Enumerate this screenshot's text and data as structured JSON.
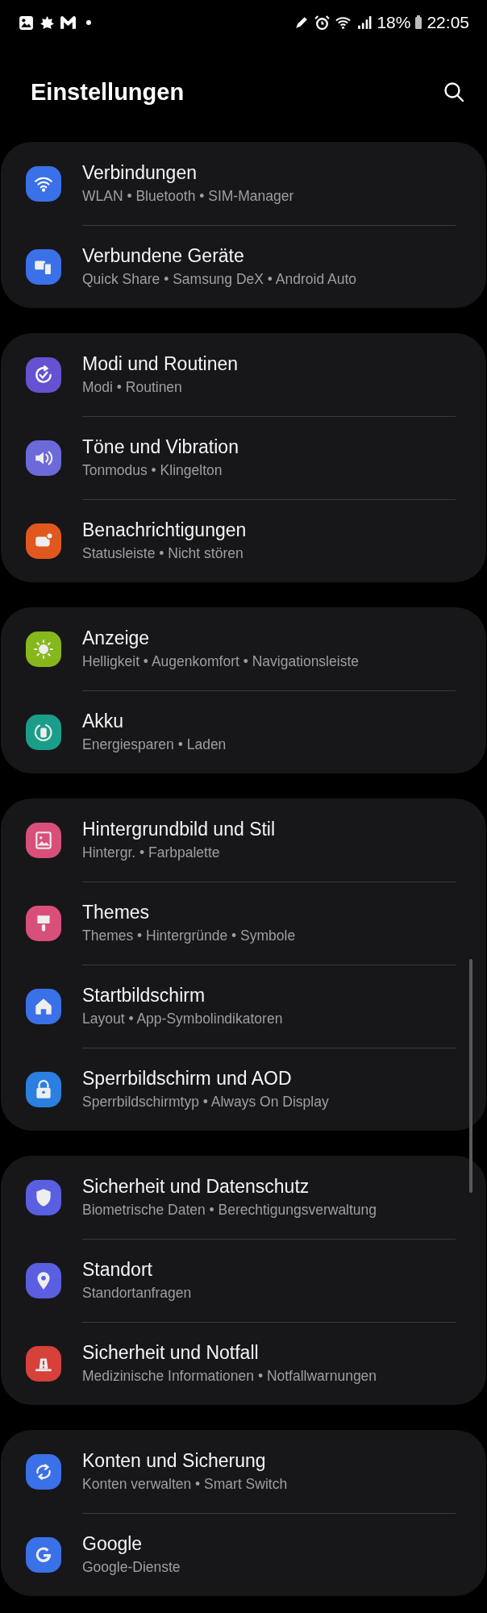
{
  "status_bar": {
    "battery": "18%",
    "time": "22:05"
  },
  "header": {
    "title": "Einstellungen"
  },
  "groups": [
    {
      "items": [
        {
          "kind": "wifi",
          "color": "#3a70e8",
          "title": "Verbindungen",
          "subtitle": "WLAN • Bluetooth • SIM-Manager"
        },
        {
          "kind": "devices",
          "color": "#3a70e8",
          "title": "Verbundene Geräte",
          "subtitle": "Quick Share • Samsung DeX • Android Auto"
        }
      ]
    },
    {
      "items": [
        {
          "kind": "modes",
          "color": "#6452d0",
          "title": "Modi und Routinen",
          "subtitle": "Modi • Routinen"
        },
        {
          "kind": "sound",
          "color": "#6c6ad8",
          "title": "Töne und Vibration",
          "subtitle": "Tonmodus • Klingelton"
        },
        {
          "kind": "notification",
          "color": "#e0581e",
          "title": "Benachrichtigungen",
          "subtitle": "Statusleiste • Nicht stören"
        }
      ]
    },
    {
      "items": [
        {
          "kind": "display",
          "color": "#86b81c",
          "title": "Anzeige",
          "subtitle": "Helligkeit • Augenkomfort • Navigationsleiste"
        },
        {
          "kind": "battery",
          "color": "#1a9e8a",
          "title": "Akku",
          "subtitle": "Energiesparen • Laden"
        }
      ]
    },
    {
      "items": [
        {
          "kind": "wallpaper",
          "color": "#d8507a",
          "title": "Hintergrundbild und Stil",
          "subtitle": "Hintergr. • Farbpalette"
        },
        {
          "kind": "themes",
          "color": "#d8507a",
          "title": "Themes",
          "subtitle": "Themes • Hintergründe • Symbole"
        },
        {
          "kind": "home",
          "color": "#3a70e8",
          "title": "Startbildschirm",
          "subtitle": "Layout • App-Symbolindikatoren"
        },
        {
          "kind": "lock",
          "color": "#2a7fe0",
          "title": "Sperrbildschirm und AOD",
          "subtitle": "Sperrbildschirmtyp • Always On Display"
        }
      ]
    },
    {
      "items": [
        {
          "kind": "shield",
          "color": "#5a5ee0",
          "title": "Sicherheit und Datenschutz",
          "subtitle": "Biometrische Daten • Berechtigungsverwaltung"
        },
        {
          "kind": "location",
          "color": "#5a5ee0",
          "title": "Standort",
          "subtitle": "Standortanfragen"
        },
        {
          "kind": "alert",
          "color": "#d8403a",
          "title": "Sicherheit und Notfall",
          "subtitle": "Medizinische Informationen • Notfallwarnungen"
        }
      ]
    },
    {
      "items": [
        {
          "kind": "sync",
          "color": "#3a70e8",
          "title": "Konten und Sicherung",
          "subtitle": "Konten verwalten • Smart Switch"
        },
        {
          "kind": "google",
          "color": "#3a70e8",
          "title": "Google",
          "subtitle": "Google-Dienste"
        }
      ]
    }
  ]
}
